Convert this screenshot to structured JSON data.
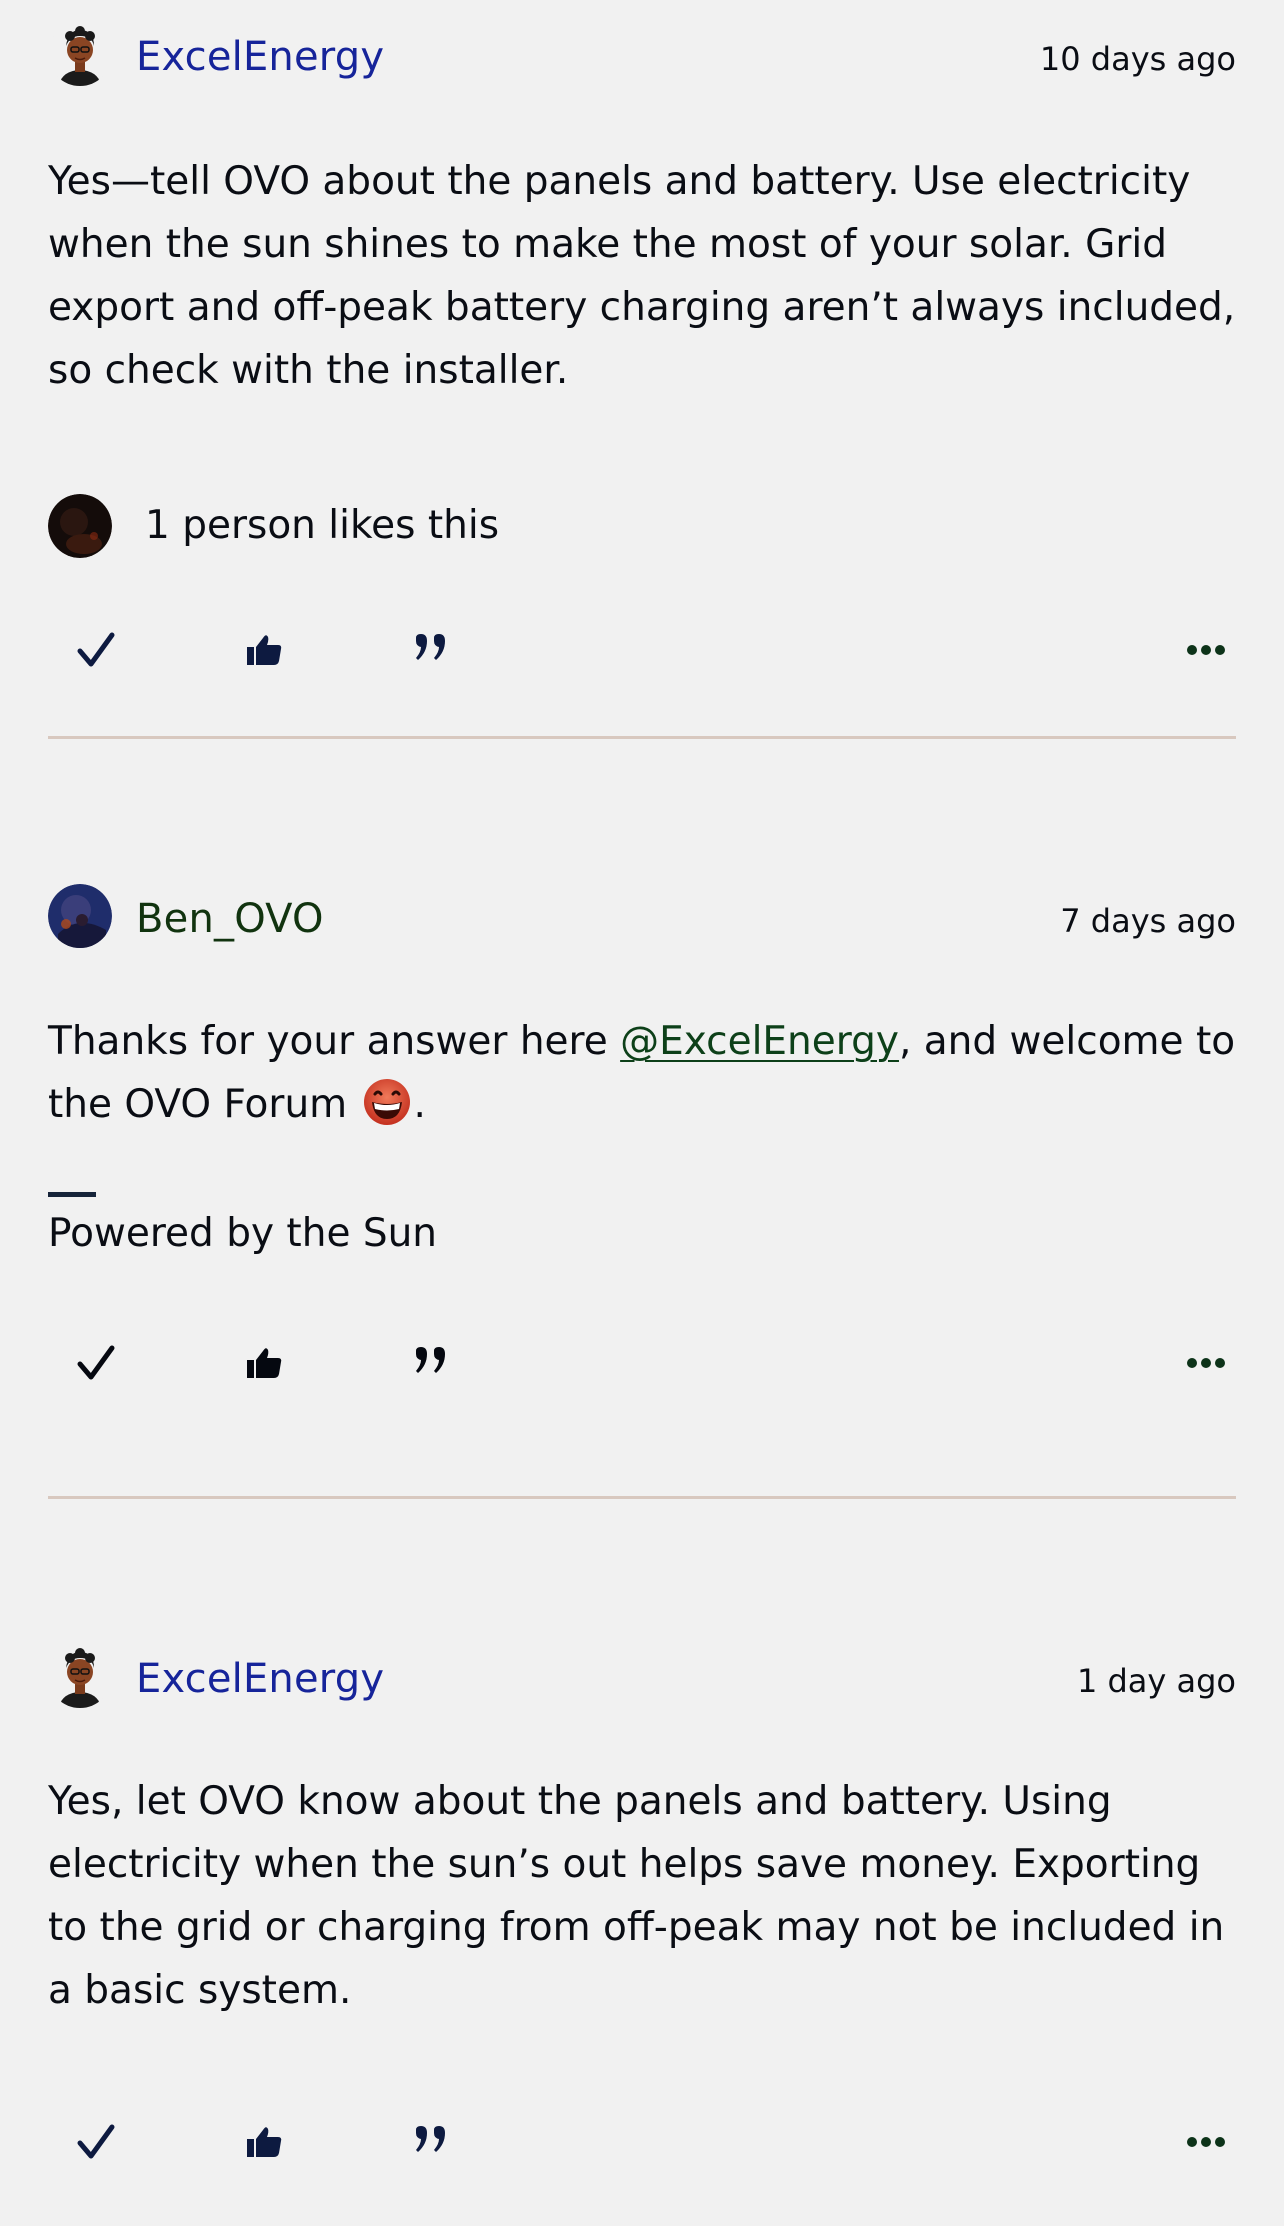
{
  "posts": [
    {
      "author": "ExcelEnergy",
      "timestamp": "10 days ago",
      "body": "Yes—tell OVO about the panels and battery. Use electricity when the sun shines to make the most of your solar. Grid export and off-peak battery charging aren’t always included, so check with the installer.",
      "likes_text": "1 person likes this"
    },
    {
      "author": "Ben_OVO",
      "timestamp": "7 days ago",
      "body_before": "Thanks for your answer here ",
      "mention": "@ExcelEnergy",
      "body_after": ", and welcome to the OVO Forum ",
      "body_end": ".",
      "emoji": "grinning-face-emoji",
      "signature": "Powered by the Sun"
    },
    {
      "author": "ExcelEnergy",
      "timestamp": "1 day ago",
      "body": "Yes, let OVO know about the panels and battery. Using electricity when the sun’s out helps save money. Exporting to the grid or charging from off-peak may not be included in a basic system."
    }
  ],
  "icons": {
    "accept_solution": "check-icon",
    "like": "thumbs-up-icon",
    "quote": "quote-icon",
    "more": "more-options-icon"
  },
  "colors": {
    "background": "#f1f1f1",
    "author_blue": "#16249a",
    "author_green": "#11330f",
    "divider": "#d8c8bf",
    "icon_navy": "#0d1a40",
    "icon_green": "#0d3319"
  }
}
